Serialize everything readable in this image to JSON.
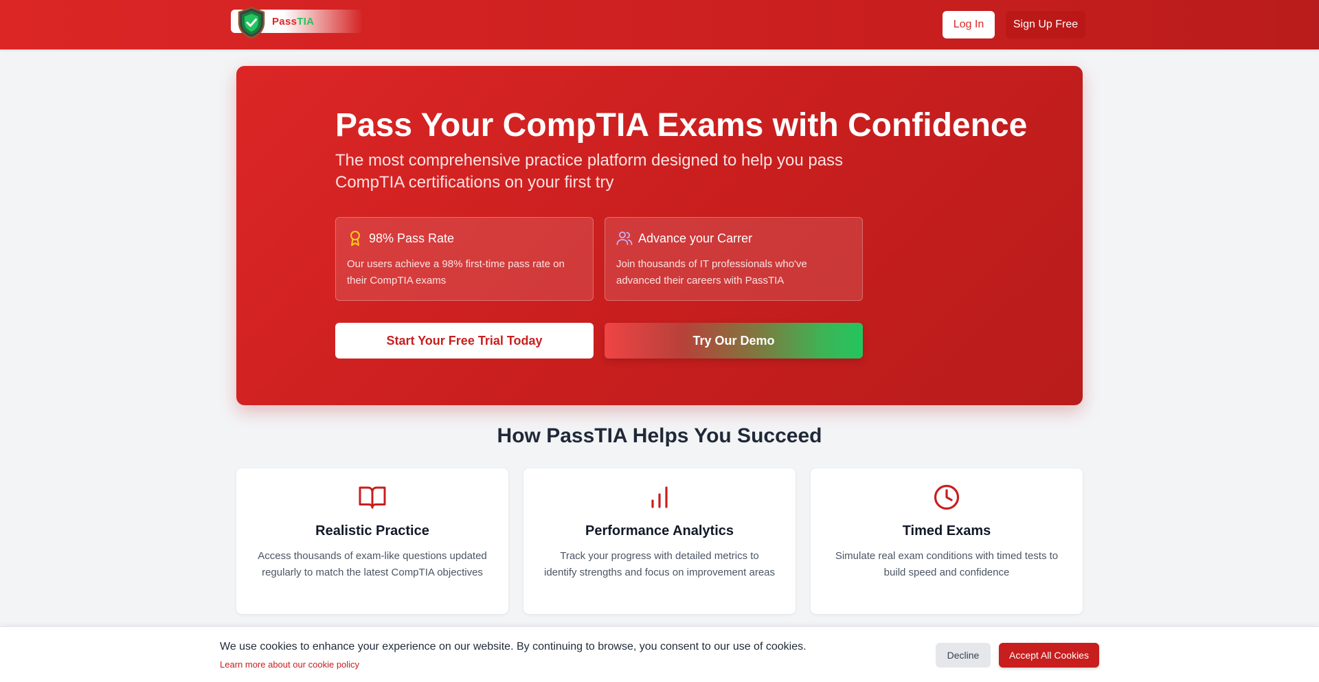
{
  "header": {
    "logo_text_part1": "Pass",
    "logo_text_part2": "TIA",
    "login_label": "Log In",
    "signup_label": "Sign Up Free"
  },
  "hero": {
    "title": "Pass Your CompTIA Exams with Confidence",
    "subtitle": "The most comprehensive practice platform designed to help you pass CompTIA certifications on your first try",
    "features": [
      {
        "icon": "award-icon",
        "title": "98% Pass Rate",
        "text": "Our users achieve a 98% first-time pass rate on their CompTIA exams"
      },
      {
        "icon": "users-icon",
        "title": "Advance your Carrer",
        "text": "Join thousands of IT professionals who've advanced their careers with PassTIA"
      }
    ],
    "primary_cta": "Start Your Free Trial Today",
    "secondary_cta": "Try Our Demo"
  },
  "section": {
    "title": "How PassTIA Helps You Succeed",
    "cards": [
      {
        "icon": "book-open-icon",
        "title": "Realistic Practice",
        "text": "Access thousands of exam-like questions updated regularly to match the latest CompTIA objectives"
      },
      {
        "icon": "bar-chart-icon",
        "title": "Performance Analytics",
        "text": "Track your progress with detailed metrics to identify strengths and focus on improvement areas"
      },
      {
        "icon": "clock-icon",
        "title": "Timed Exams",
        "text": "Simulate real exam conditions with timed tests to build speed and confidence"
      }
    ]
  },
  "cookie_banner": {
    "message": "We use cookies to enhance your experience on our website. By continuing to browse, you consent to our use of cookies.",
    "link_text": "Learn more about our cookie policy",
    "decline_label": "Decline",
    "accept_label": "Accept All Cookies"
  },
  "colors": {
    "brand_red": "#dc2626",
    "brand_red_dark": "#b91c1c",
    "brand_green": "#22c55e",
    "award_yellow": "#facc15",
    "users_lavender": "#c4b5fd"
  }
}
